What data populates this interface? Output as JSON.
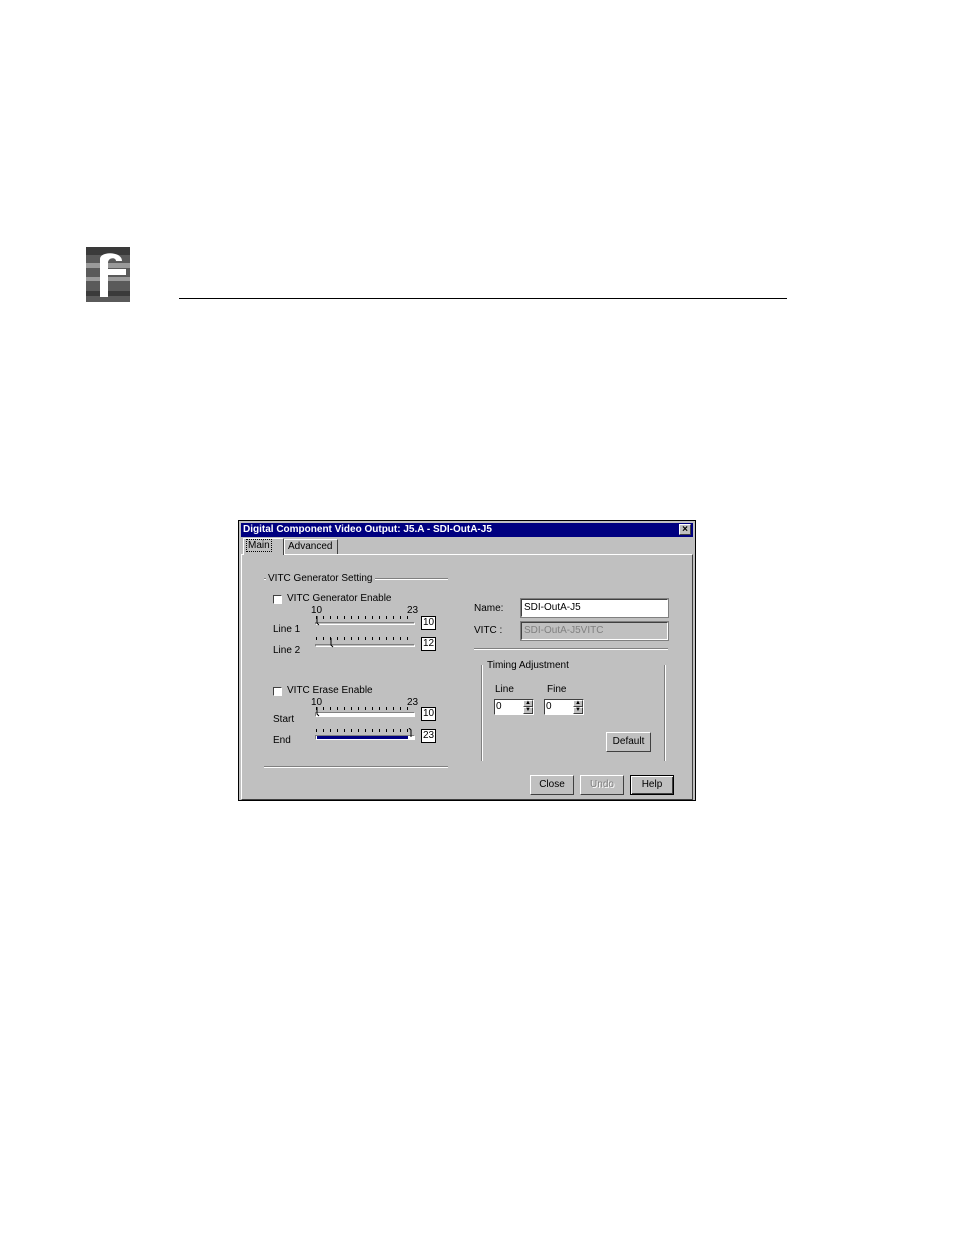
{
  "dialog": {
    "title": "Digital Component Video Output: J5.A - SDI-OutA-J5",
    "close_glyph": "×",
    "tabs": [
      {
        "label": "Main"
      },
      {
        "label": "Advanced"
      }
    ]
  },
  "vitc_generator": {
    "group_label": "VITC Generator Setting",
    "generator_enable_label": "VITC Generator Enable",
    "generator_enable_checked": false,
    "range_min": "10",
    "range_max": "23",
    "line1": {
      "label": "Line 1",
      "value": "10"
    },
    "line2": {
      "label": "Line 2",
      "value": "12"
    },
    "erase_enable_label": "VITC Erase Enable",
    "erase_enable_checked": false,
    "erase_range_min": "10",
    "erase_range_max": "23",
    "start": {
      "label": "Start",
      "value": "10"
    },
    "end": {
      "label": "End",
      "value": "23"
    }
  },
  "name_field": {
    "label": "Name:",
    "value": "SDI-OutA-J5"
  },
  "vitc_field": {
    "label": "VITC :",
    "value": "SDI-OutA-J5VITC"
  },
  "timing": {
    "group_label": "Timing Adjustment",
    "line": {
      "label": "Line",
      "value": "0"
    },
    "fine": {
      "label": "Fine",
      "value": "0"
    },
    "default_label": "Default"
  },
  "buttons": {
    "close_label": "Close",
    "undo_label": "Undo",
    "help_label": "Help"
  }
}
